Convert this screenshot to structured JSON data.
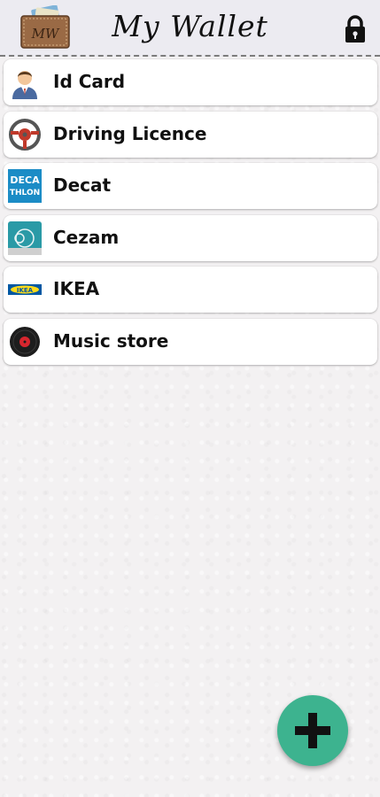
{
  "header": {
    "title": "My Wallet",
    "logo_text": "MW",
    "logo_icon": "wallet-icon",
    "lock_icon": "lock-icon"
  },
  "cards": [
    {
      "label": "Id Card",
      "icon": "person-icon"
    },
    {
      "label": "Driving Licence",
      "icon": "steering-wheel-icon"
    },
    {
      "label": "Decat",
      "icon": "decathlon-logo-icon",
      "icon_text": "DECA THLON"
    },
    {
      "label": "Cezam",
      "icon": "cezam-logo-icon"
    },
    {
      "label": "IKEA",
      "icon": "ikea-logo-icon",
      "icon_text": "IKEA"
    },
    {
      "label": "Music store",
      "icon": "vinyl-record-icon"
    }
  ],
  "fab": {
    "icon": "plus-icon"
  },
  "colors": {
    "header_bg": "#ecebf1",
    "fab": "#3db38f",
    "background": "#f3f1f2"
  }
}
